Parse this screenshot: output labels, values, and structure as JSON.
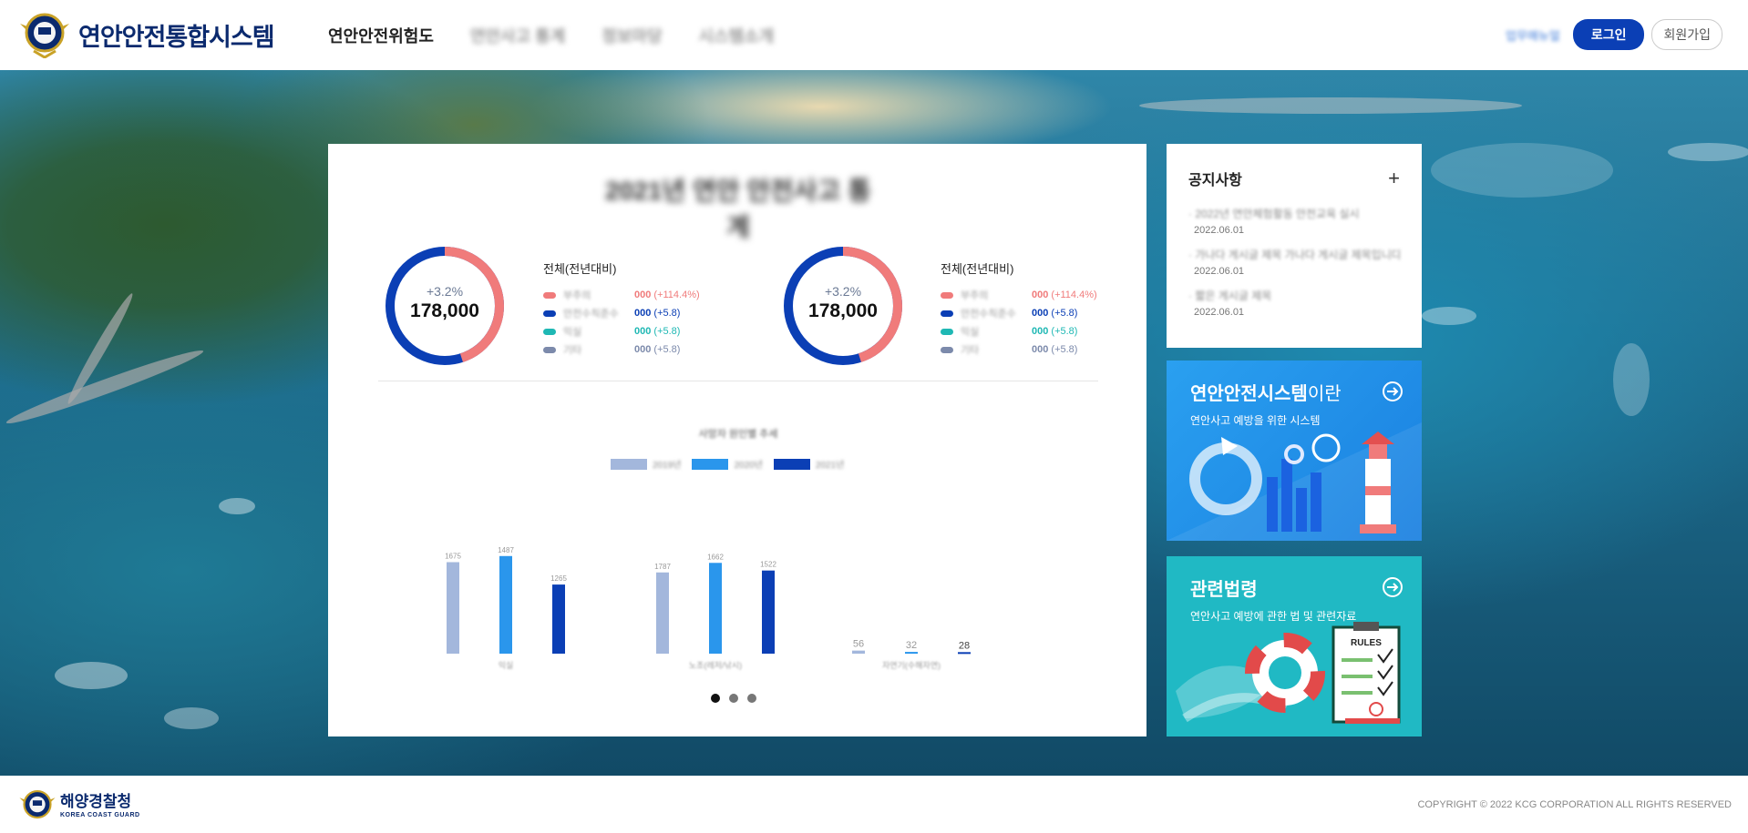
{
  "header": {
    "title": "연안안전통합시스템",
    "nav": [
      "연안안전위험도",
      "연안사고 통계",
      "정보마당",
      "시스템소개"
    ],
    "small_link": "업무매뉴얼",
    "login_label": "로그인",
    "join_label": "회원가입"
  },
  "main": {
    "card_title": "2021년 연안 안전사고 통계",
    "donuts": [
      {
        "subtitle": "+3.2%",
        "value": "178,000",
        "ratio": 0.45
      },
      {
        "subtitle": "+3.2%",
        "value": "178,000",
        "ratio": 0.45
      }
    ],
    "legends": [
      {
        "title": "전체(전년대비)",
        "rows": [
          {
            "name": "부주의",
            "value": "000",
            "change": "(+114.4%)",
            "color": "#f07b7b"
          },
          {
            "name": "안전수칙준수",
            "value": "000",
            "change": "(+5.8)",
            "color": "#0b3fb5"
          },
          {
            "name": "익실",
            "value": "000",
            "change": "(+5.8)",
            "color": "#1fb8b4"
          },
          {
            "name": "기타",
            "value": "000",
            "change": "(+5.8)",
            "color": "#7c8aab"
          }
        ]
      },
      {
        "title": "전체(전년대비)",
        "rows": [
          {
            "name": "부주의",
            "value": "000",
            "change": "(+114.4%)",
            "color": "#f07b7b"
          },
          {
            "name": "안전수칙준수",
            "value": "000",
            "change": "(+5.8)",
            "color": "#0b3fb5"
          },
          {
            "name": "익실",
            "value": "000",
            "change": "(+5.8)",
            "color": "#1fb8b4"
          },
          {
            "name": "기타",
            "value": "000",
            "change": "(+5.8)",
            "color": "#7c8aab"
          }
        ]
      }
    ],
    "bar_chart_title": "사망자 원인별 추세",
    "page_dots": 3,
    "active_dot": 0
  },
  "chart_data": {
    "type": "bar",
    "title": "사망자 원인별 추세",
    "categories": [
      "익실",
      "노조(레저/낚시)",
      "자연기(수해자연)"
    ],
    "series": [
      {
        "name": "2019년",
        "values": [
          1675,
          1487,
          56
        ],
        "color": "#a3b7dc"
      },
      {
        "name": "2020년",
        "values": [
          1787,
          1662,
          32
        ],
        "color": "#2a96ec"
      },
      {
        "name": "2021년",
        "values": [
          1265,
          1522,
          28
        ],
        "color": "#0b3fb5"
      }
    ],
    "data_labels": [
      [
        "1675",
        "1487",
        "1265"
      ],
      [
        "1787",
        "1662",
        "1522"
      ],
      [
        "56",
        "32",
        "28"
      ]
    ],
    "ylim": [
      0,
      2000
    ],
    "legend": "top-center"
  },
  "notice": {
    "title": "공지사항",
    "plus_icon": "plus-icon",
    "items": [
      {
        "text": "2022년 연안체험활동 안전교육 실시",
        "date": "2022.06.01"
      },
      {
        "text": "가나다 게시글 제목 가나다 게시글 제목입니다",
        "date": "2022.06.01"
      },
      {
        "text": "짧은 게시글 제목",
        "date": "2022.06.01"
      }
    ]
  },
  "promo1": {
    "title_bold": "연안안전시스템",
    "title_light": "이란",
    "subtitle": "연안사고 예방을 위한 시스템"
  },
  "promo2": {
    "title_bold": "관련법령",
    "subtitle": "연안사고 예방에 관한 법 및 관련자료",
    "rules_label": "RULES"
  },
  "footer": {
    "name": "해양경찰청",
    "eng": "KOREA COAST GUARD",
    "copyright": "COPYRIGHT © 2022 KCG CORPORATION ALL RIGHTS RESERVED"
  },
  "colors": {
    "brand": "#0b2a6e",
    "accent": "#0b3fb5",
    "coral": "#f07b7b",
    "teal": "#20b9c4",
    "sky": "#2aa0f0"
  }
}
